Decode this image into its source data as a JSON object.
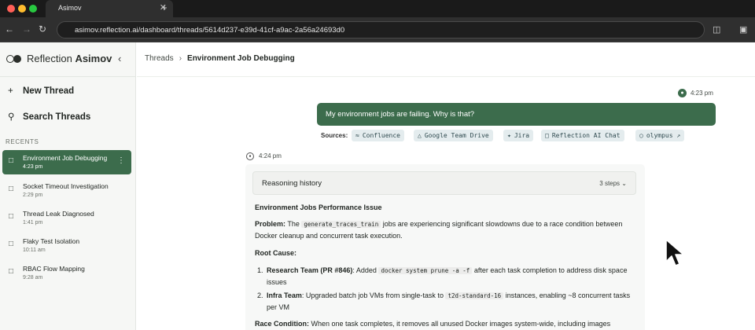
{
  "browser": {
    "tab_title": "Asimov",
    "tab_close": "✕",
    "new_tab": "+",
    "url": "asimov.reflection.ai/dashboard/threads/5614d237-e39d-41cf-a9ac-2a56a24693d0"
  },
  "sidebar": {
    "brand_prefix": "Reflection",
    "brand_name": "Asimov",
    "new_thread": "New Thread",
    "search_threads": "Search Threads",
    "recents_label": "RECENTS",
    "threads": [
      {
        "title": "Environment Job Debugging",
        "time": "4:23 pm",
        "active": true
      },
      {
        "title": "Socket Timeout Investigation",
        "time": "2:29 pm"
      },
      {
        "title": "Thread Leak Diagnosed",
        "time": "1:41 pm"
      },
      {
        "title": "Flaky Test Isolation",
        "time": "10:11 am"
      },
      {
        "title": "RBAC Flow Mapping",
        "time": "9:28 am"
      }
    ]
  },
  "breadcrumb": {
    "root": "Threads",
    "current": "Environment Job Debugging"
  },
  "user_message": {
    "time": "4:23 pm",
    "text": "My environment jobs are failing. Why is that?"
  },
  "sources": {
    "label": "Sources:",
    "items": [
      {
        "label": "Confluence",
        "icon": "confluence-icon"
      },
      {
        "label": "Google Team Drive",
        "icon": "drive-icon"
      },
      {
        "label": "Jira",
        "icon": "jira-icon"
      },
      {
        "label": "Reflection AI Chat",
        "icon": "chat-icon"
      },
      {
        "label": "olympus",
        "icon": "github-icon"
      }
    ]
  },
  "assistant": {
    "time": "4:24 pm",
    "reasoning_label": "Reasoning history",
    "reasoning_steps": "3 steps",
    "heading": "Environment Jobs Performance Issue",
    "problem_label": "Problem:",
    "problem_pre": "The",
    "problem_code": "generate_traces_train",
    "problem_post": "jobs are experiencing significant slowdowns due to a race condition between Docker cleanup and concurrent task execution.",
    "root_cause_label": "Root Cause:",
    "causes": [
      {
        "label": "Research Team (PR #846)",
        "pre": ": Added",
        "code": "docker system prune -a -f",
        "post": "after each task completion to address disk space issues"
      },
      {
        "label": "Infra Team",
        "pre": ": Upgraded batch job VMs from single-task to",
        "code": "t2d-standard-16",
        "post": "instances, enabling ~8 concurrent tasks per VM"
      }
    ],
    "race_label": "Race Condition:",
    "race_text": "When one task completes, it removes all unused Docker images system-wide, including images"
  },
  "colors": {
    "accent": "#3c6c4c",
    "chip_bg": "#e4ecee"
  }
}
